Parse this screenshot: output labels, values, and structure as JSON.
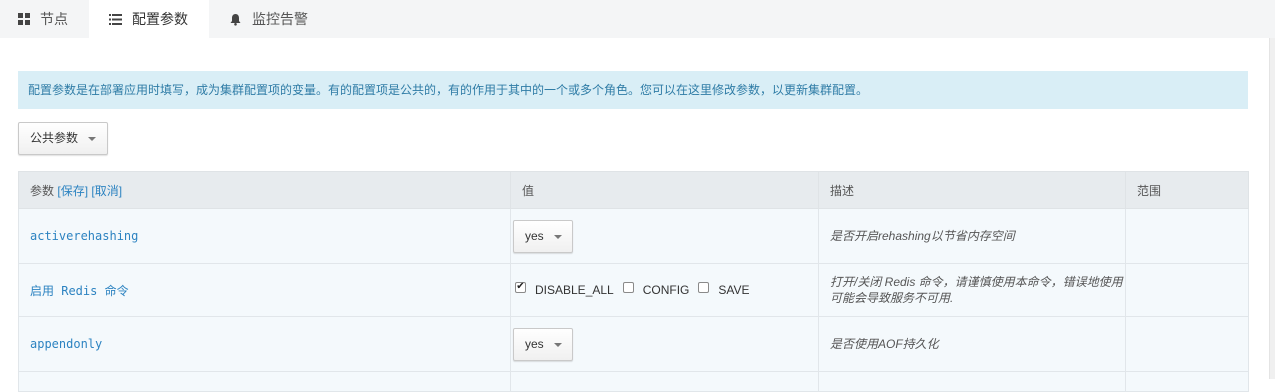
{
  "tabs": [
    {
      "label": "节点",
      "icon": "grid-icon",
      "active": false
    },
    {
      "label": "配置参数",
      "icon": "list-icon",
      "active": true
    },
    {
      "label": "监控告警",
      "icon": "bell-icon",
      "active": false
    }
  ],
  "info_banner": "配置参数是在部署应用时填写，成为集群配置项的变量。有的配置项是公共的，有的作用于其中的一个或多个角色。您可以在这里修改参数，以更新集群配置。",
  "role_dropdown": {
    "value": "公共参数"
  },
  "table": {
    "headers": {
      "param": "参数",
      "save": "[保存]",
      "cancel": "[取消]",
      "value": "值",
      "description": "描述",
      "scope": "范围"
    },
    "rows": [
      {
        "name": "activerehashing",
        "value": "yes",
        "description": "是否开启rehashing以节省内存空间",
        "scope": ""
      },
      {
        "name": "启用 Redis 命令",
        "options": [
          {
            "label": "DISABLE_ALL",
            "checked": true
          },
          {
            "label": "CONFIG",
            "checked": false
          },
          {
            "label": "SAVE",
            "checked": false
          }
        ],
        "description": "打开/关闭 Redis 命令，请谨慎使用本命令，错误地使用可能会导致服务不可用.",
        "scope": ""
      },
      {
        "name": "appendonly",
        "value": "yes",
        "description": "是否使用AOF持久化",
        "scope": ""
      }
    ]
  }
}
